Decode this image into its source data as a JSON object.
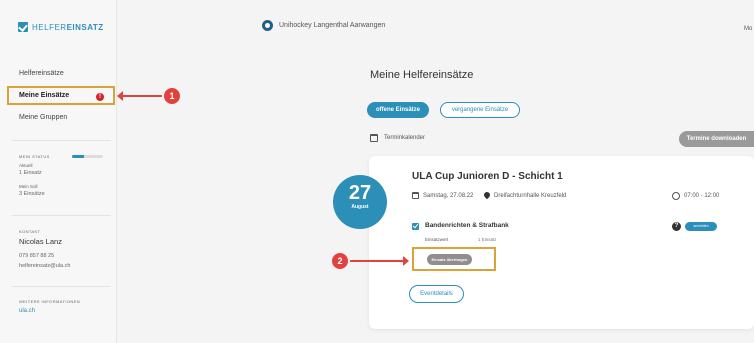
{
  "brand": {
    "prefix": "HELFER",
    "suffix": "EINSATZ",
    "accent": "#2c8fb8"
  },
  "header": {
    "org_name": "Unihockey Langenthal Aarwangen",
    "user_short": "Mo"
  },
  "sidebar": {
    "items": [
      {
        "label": "Helfereinsätze"
      },
      {
        "label": "Meine Einsätze",
        "badge": "!"
      },
      {
        "label": "Meine Gruppen"
      }
    ],
    "status": {
      "heading": "MEIN STATUS",
      "progress": 0.4,
      "current_label": "Aktuell",
      "current_value": "1 Einsatz",
      "target_label": "Mein Soll",
      "target_value": "3 Einsätze"
    },
    "contact": {
      "heading": "KONTAKT",
      "name": "Nicolas Lanz",
      "phone": "079 857 88 25",
      "email": "helfereinsatz@ula.ch"
    },
    "more": {
      "heading": "WEITERE INFORMATIONEN",
      "link": "ula.ch"
    }
  },
  "main": {
    "title": "Meine Helfereinsätze",
    "tabs": [
      {
        "label": "offene Einsätze"
      },
      {
        "label": "vergangene Einsätze"
      }
    ],
    "calendar_label": "Terminkalender",
    "download_label": "Termine downloaden"
  },
  "event": {
    "day": "27",
    "month": "August",
    "title": "ULA Cup Junioren D - Schicht 1",
    "date": "Samstag, 27.08.22",
    "location": "Dreifachturnhalle Kreuzfeld",
    "time": "07:00 - 12:00",
    "task": {
      "title": "Bandenrichten & Strafbank",
      "info": "?",
      "toggle_label": "anmelden",
      "value_label": "Einsatzwert",
      "value": "1 Einsatz",
      "transfer_label": "Einsatz übertragen"
    },
    "details_label": "Eventdetails"
  },
  "annotations": [
    {
      "number": "1"
    },
    {
      "number": "2"
    }
  ],
  "colors": {
    "highlight": "#d9a33a",
    "annotation": "#e3413e"
  }
}
